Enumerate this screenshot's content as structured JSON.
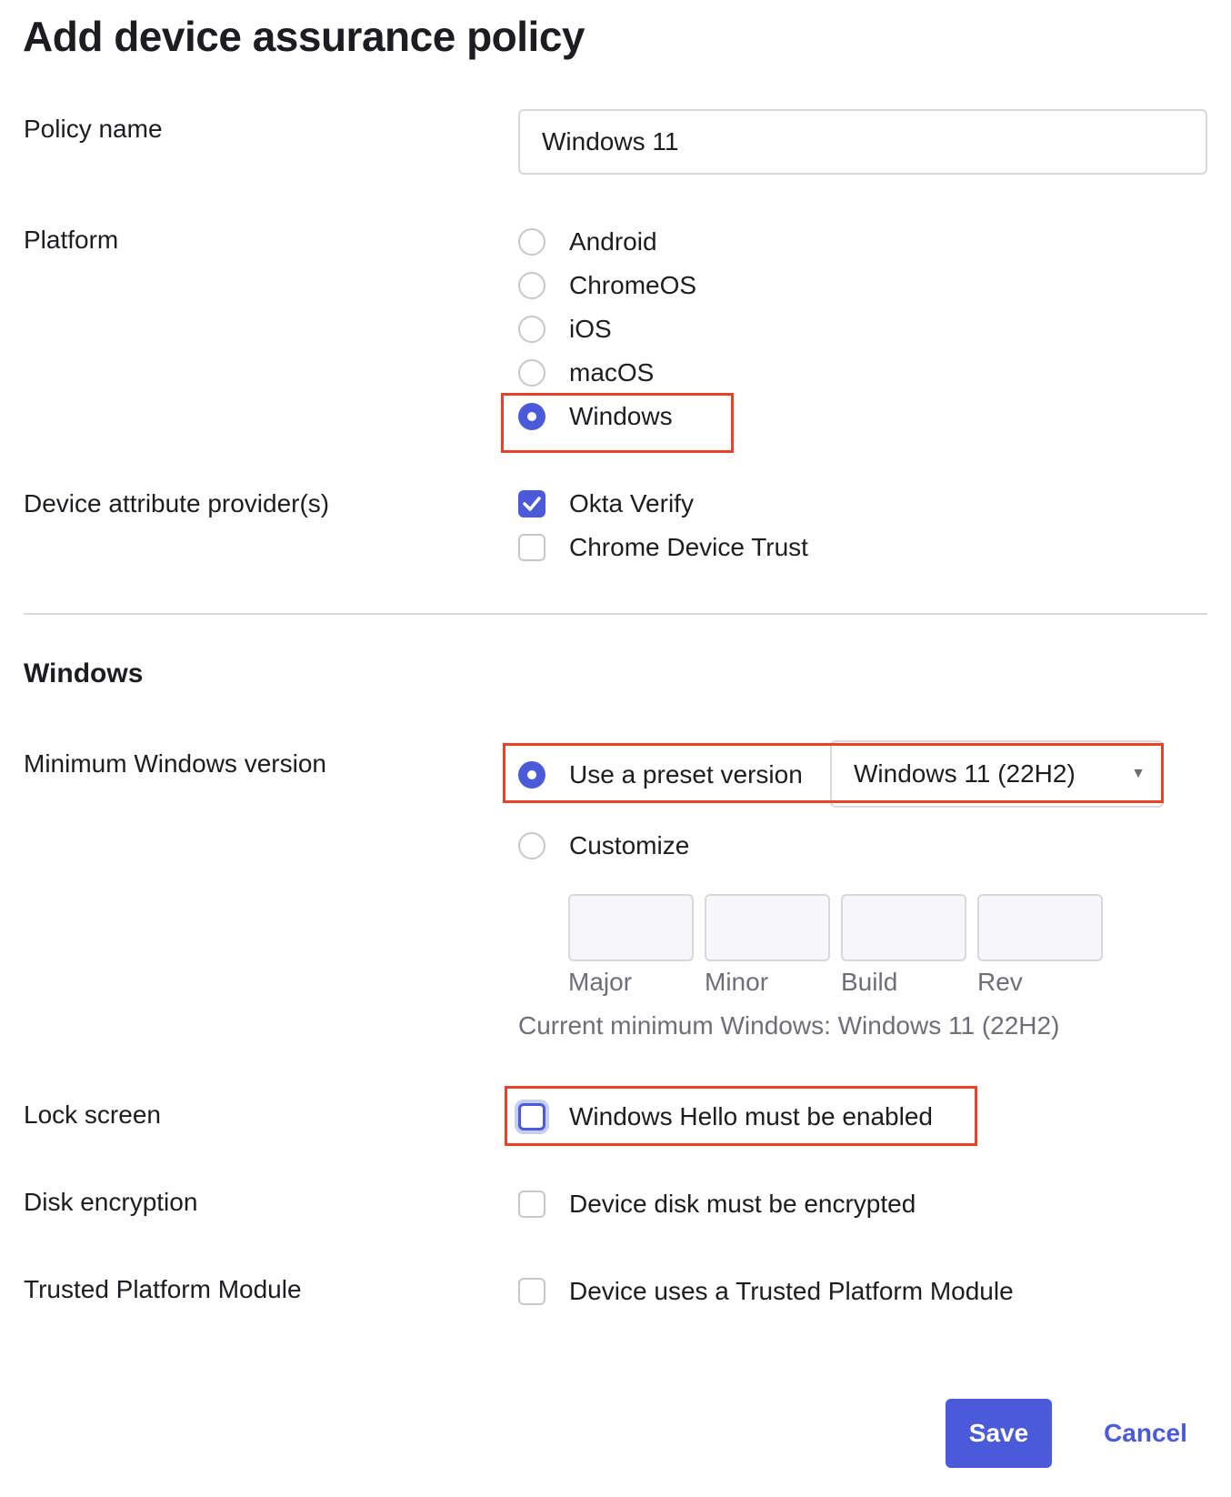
{
  "page": {
    "title": "Add device assurance policy"
  },
  "policy_name": {
    "label": "Policy name",
    "value": "Windows 11"
  },
  "platform": {
    "label": "Platform",
    "options": [
      "Android",
      "ChromeOS",
      "iOS",
      "macOS",
      "Windows"
    ],
    "selected": "Windows"
  },
  "providers": {
    "label": "Device attribute provider(s)",
    "options": [
      {
        "label": "Okta Verify",
        "checked": true
      },
      {
        "label": "Chrome Device Trust",
        "checked": false
      }
    ]
  },
  "windows_section": {
    "title": "Windows",
    "min_version": {
      "label": "Minimum Windows version",
      "preset_label": "Use a preset version",
      "preset_selected": true,
      "preset_value": "Windows 11 (22H2)",
      "customize_label": "Customize",
      "fields": [
        "Major",
        "Minor",
        "Build",
        "Rev"
      ],
      "hint": "Current minimum Windows: Windows 11 (22H2)"
    },
    "lock_screen": {
      "label": "Lock screen",
      "option": "Windows Hello must be enabled",
      "checked": false
    },
    "disk_encryption": {
      "label": "Disk encryption",
      "option": "Device disk must be encrypted",
      "checked": false
    },
    "tpm": {
      "label": "Trusted Platform Module",
      "option": "Device uses a Trusted Platform Module",
      "checked": false
    }
  },
  "actions": {
    "save_label": "Save",
    "cancel_label": "Cancel"
  },
  "colors": {
    "accent": "#4b5ad9",
    "highlight": "#e8412c"
  }
}
